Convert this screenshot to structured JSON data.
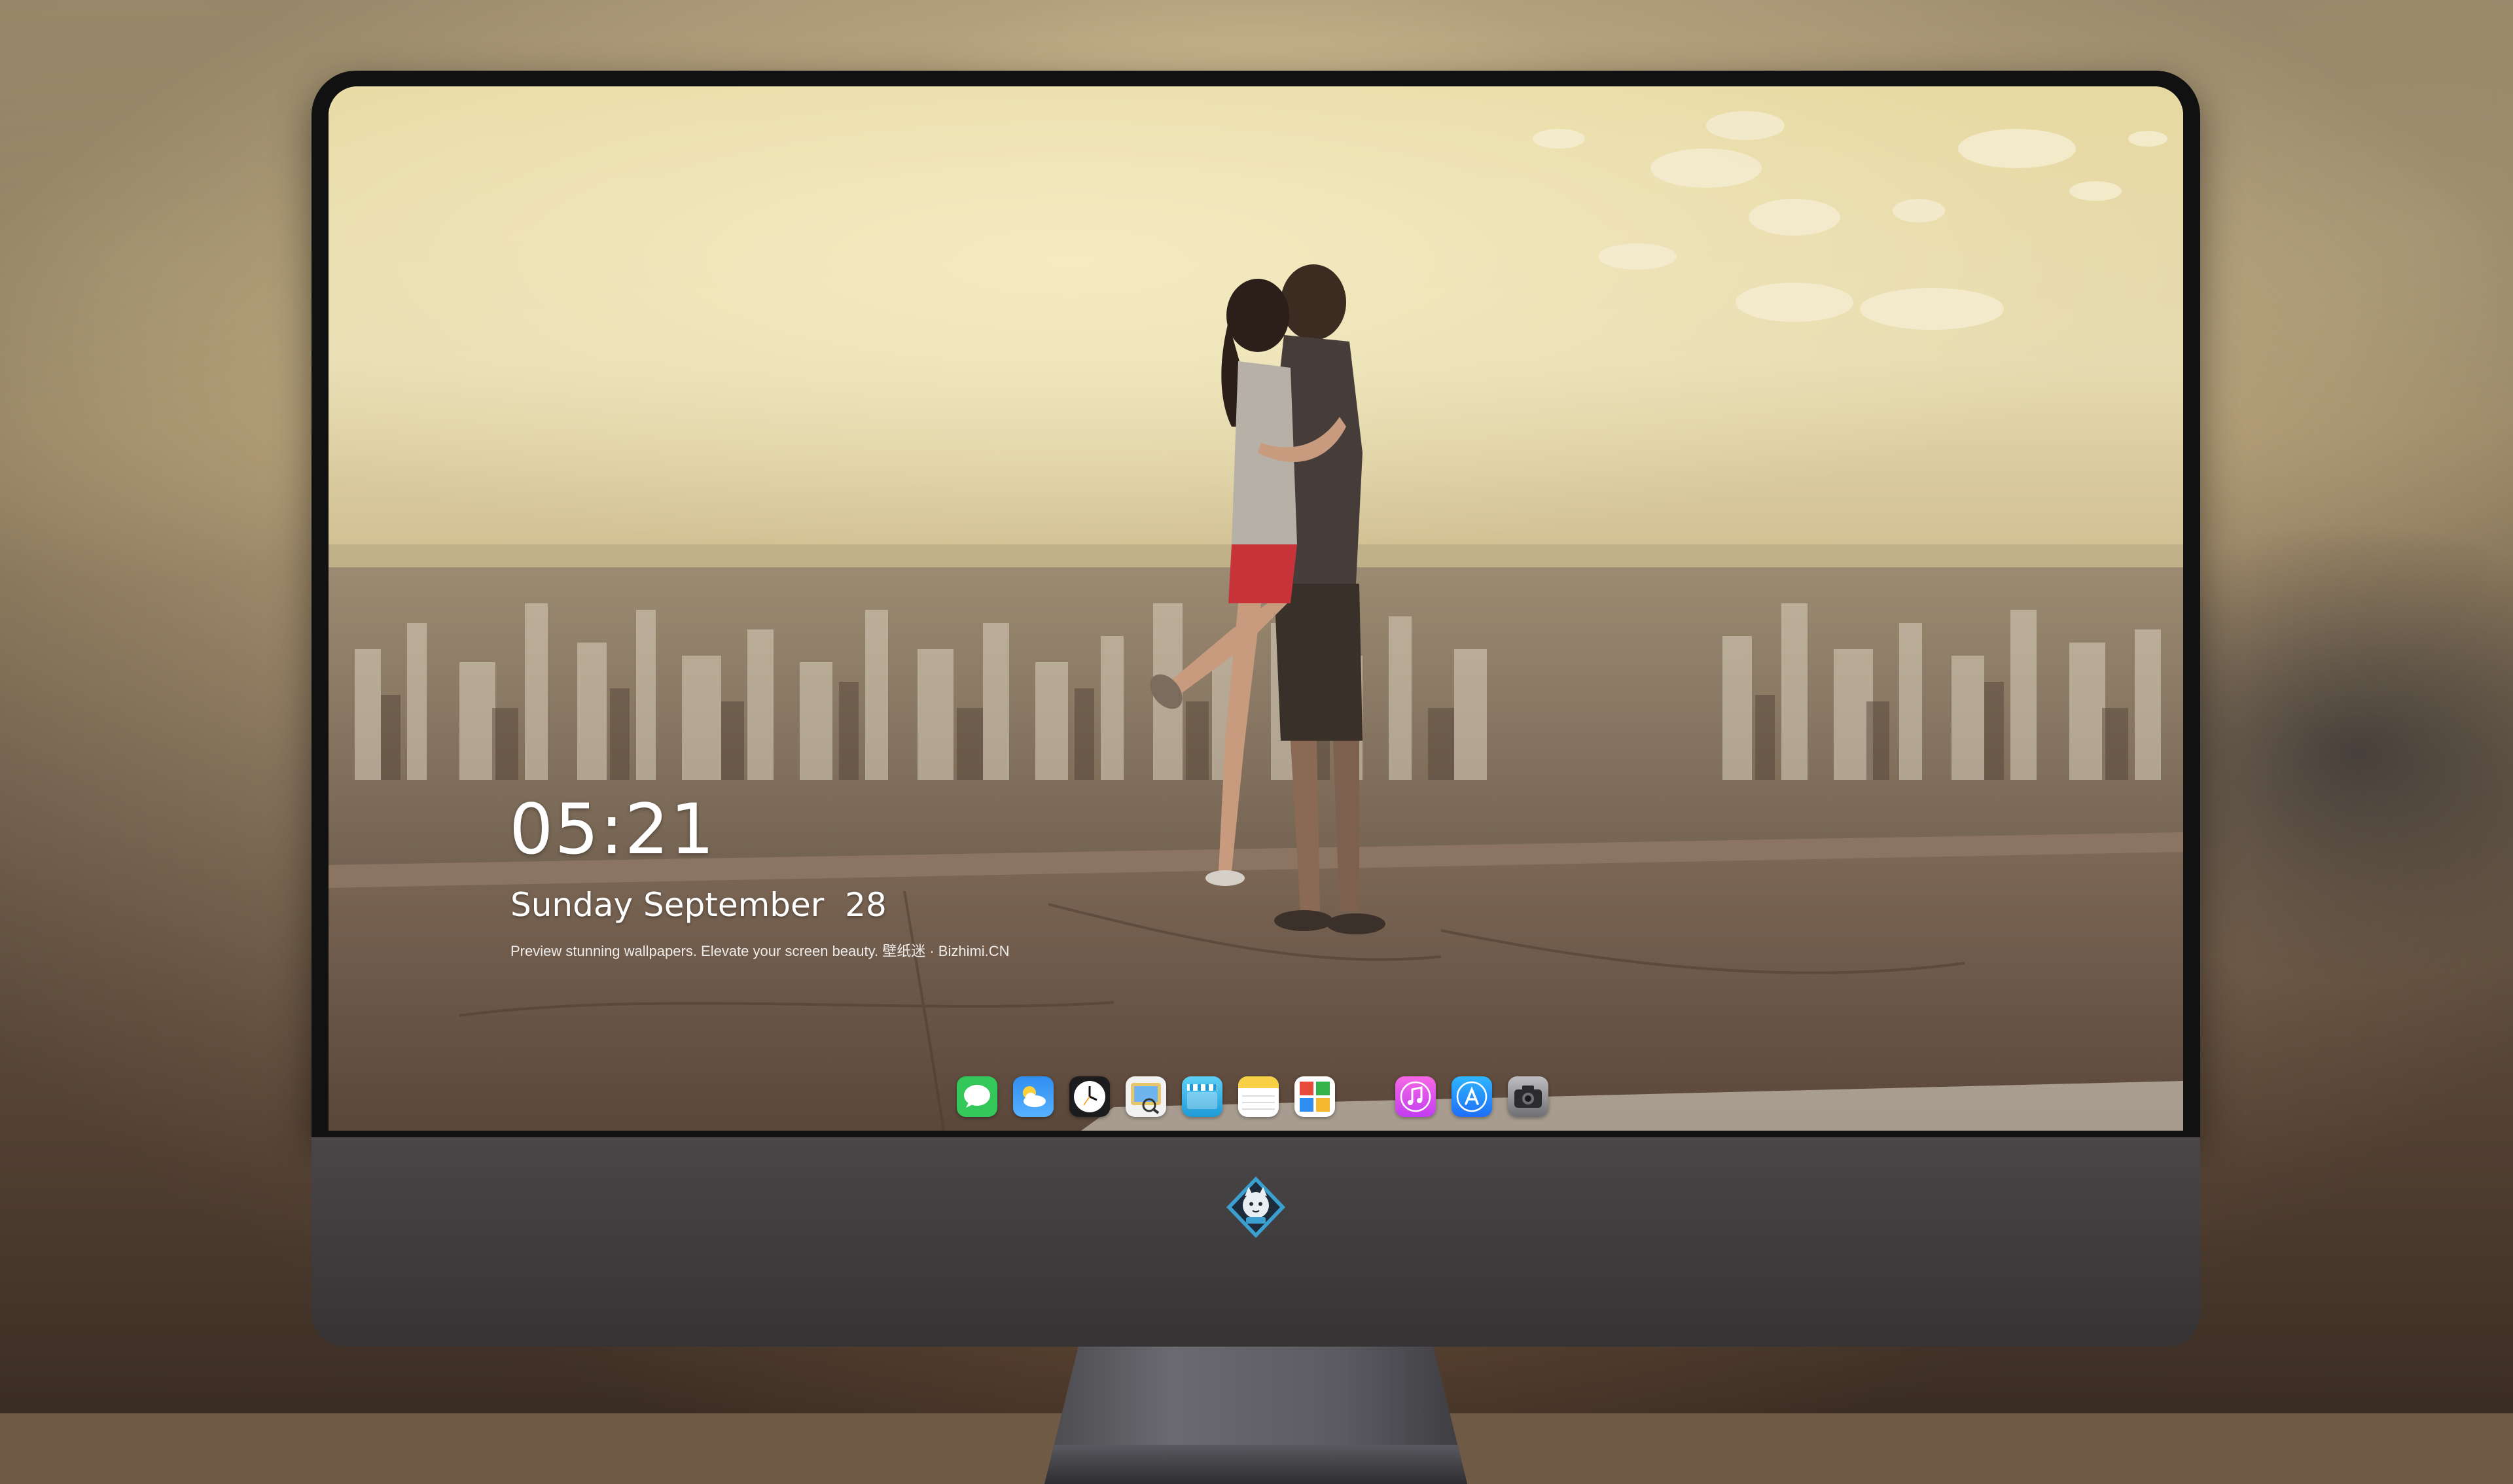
{
  "lockscreen": {
    "time": "05:21",
    "date": "Sunday September  28",
    "caption": "Preview stunning wallpapers. Elevate your screen beauty. 壁纸迷 · Bizhimi.CN"
  },
  "dock": {
    "apps": [
      {
        "name": "messages-icon",
        "color": "#34c759"
      },
      {
        "name": "weather-icon",
        "color": "#2f8ef0"
      },
      {
        "name": "clock-icon",
        "color": "#1c1c1e"
      },
      {
        "name": "preview-icon",
        "color": "#e8c76a"
      },
      {
        "name": "clips-icon",
        "color": "#2ab2e8"
      },
      {
        "name": "notes-icon",
        "color": "#f7d046"
      },
      {
        "name": "photo-booth-icon",
        "color": "#e84a3b"
      },
      {
        "name": "music-icon",
        "color": "#e84bd7"
      },
      {
        "name": "app-store-icon",
        "color": "#1e8ef7"
      },
      {
        "name": "camera-icon",
        "color": "#8e8e93"
      }
    ]
  },
  "monitor": {
    "logo": "tiger-badge-icon"
  }
}
